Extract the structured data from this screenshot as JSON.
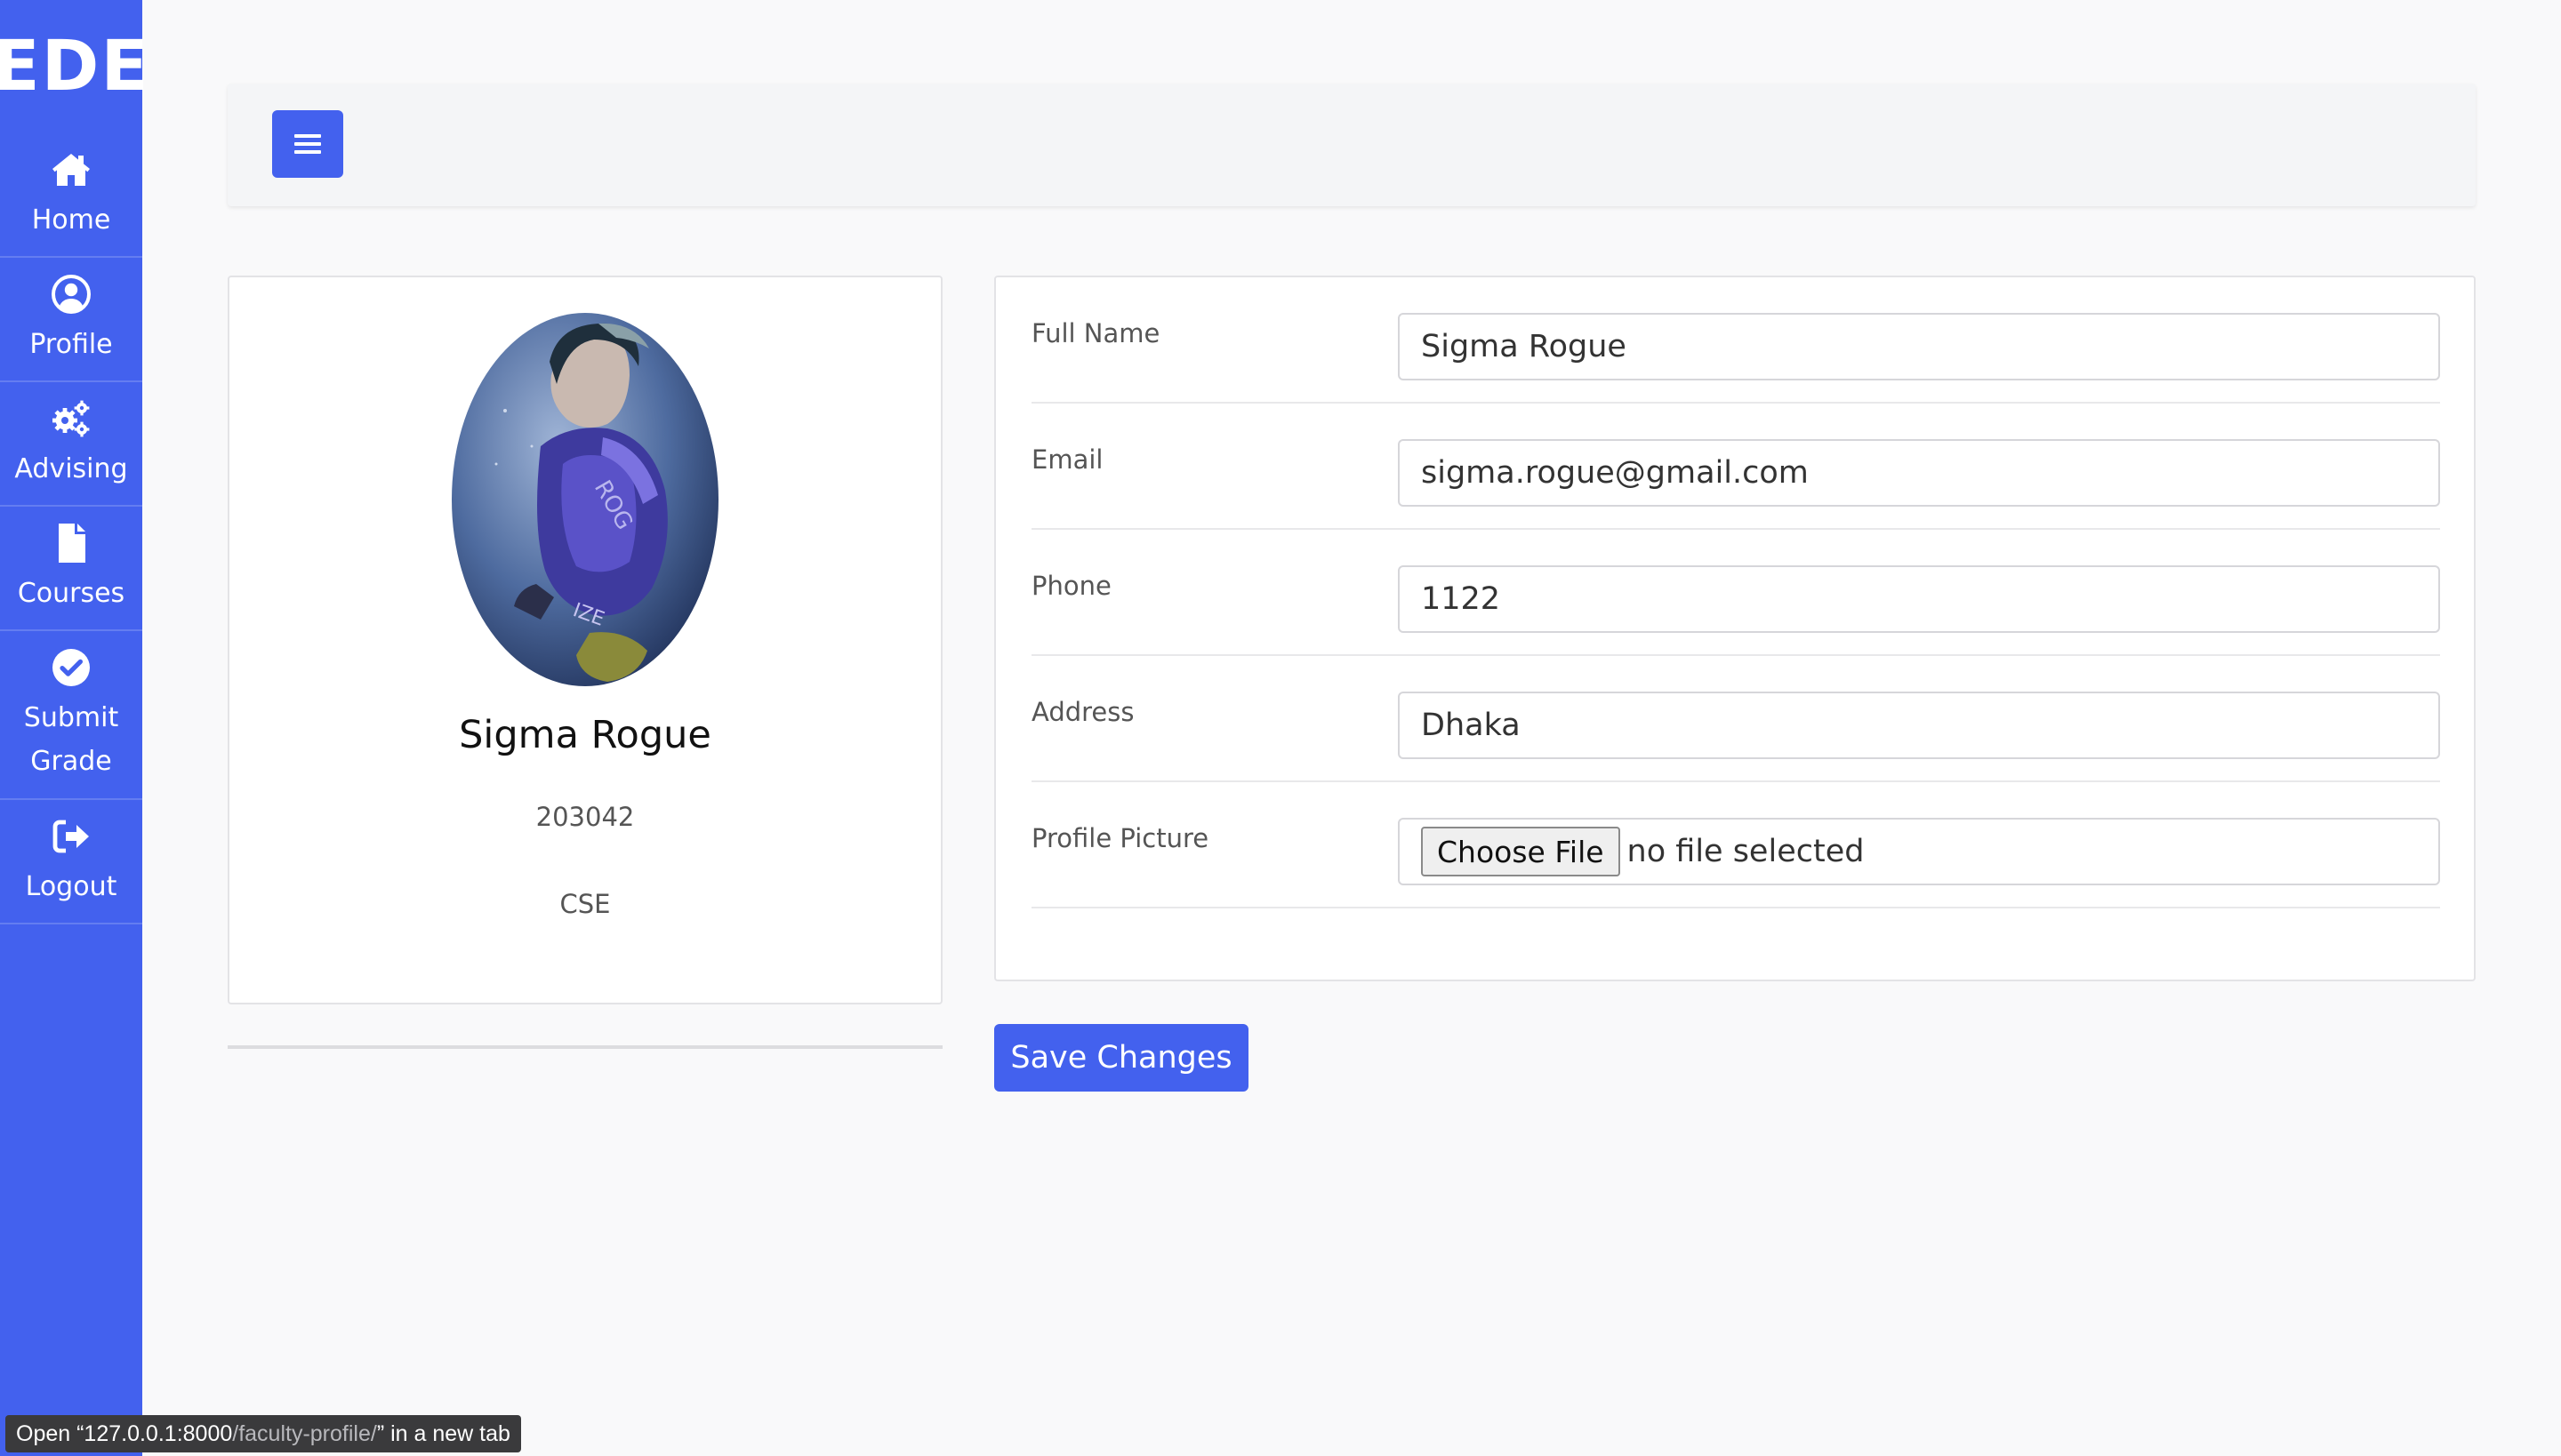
{
  "sidebar": {
    "logo": "EDE",
    "items": [
      {
        "label": "Home",
        "icon": "home-icon"
      },
      {
        "label": "Profile",
        "icon": "user-circle-icon"
      },
      {
        "label": "Advising",
        "icon": "gears-icon"
      },
      {
        "label": "Courses",
        "icon": "file-icon"
      },
      {
        "label": "Submit Grade",
        "icon": "check-circle-icon"
      },
      {
        "label": "Logout",
        "icon": "sign-out-icon"
      }
    ],
    "color": "#4361ee"
  },
  "topbar": {
    "menu_icon": "hamburger-icon"
  },
  "profile": {
    "name": "Sigma Rogue",
    "id": "203042",
    "department": "CSE"
  },
  "form": {
    "fields": [
      {
        "label": "Full Name",
        "value": "Sigma Rogue"
      },
      {
        "label": "Email",
        "value": "sigma.rogue@gmail.com"
      },
      {
        "label": "Phone",
        "value": "1122"
      },
      {
        "label": "Address",
        "value": "Dhaka"
      }
    ],
    "picture": {
      "label": "Profile Picture",
      "button": "Choose File",
      "status": "no file selected"
    },
    "save_label": "Save Changes"
  },
  "status_bar": {
    "prefix": "Open “127.0.0.1:8000",
    "path": "/faculty-profile/",
    "suffix": "” in a new tab"
  }
}
